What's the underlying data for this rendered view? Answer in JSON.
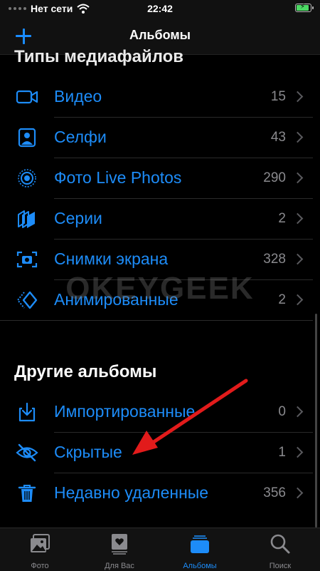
{
  "status_bar": {
    "carrier": "Нет сети",
    "time": "22:42",
    "battery_percent": 90
  },
  "nav": {
    "title": "Альбомы",
    "add_icon": "plus-icon"
  },
  "sections": {
    "media_types_title": "Типы медиафайлов",
    "media_types": [
      {
        "icon": "video-icon",
        "label": "Видео",
        "count": "15"
      },
      {
        "icon": "selfie-icon",
        "label": "Селфи",
        "count": "43"
      },
      {
        "icon": "live-photos-icon",
        "label": "Фото Live Photos",
        "count": "290"
      },
      {
        "icon": "burst-icon",
        "label": "Серии",
        "count": "2"
      },
      {
        "icon": "screenshot-icon",
        "label": "Снимки экрана",
        "count": "328"
      },
      {
        "icon": "animated-icon",
        "label": "Анимированные",
        "count": "2"
      }
    ],
    "other_title": "Другие альбомы",
    "other": [
      {
        "icon": "import-icon",
        "label": "Импортированные",
        "count": "0"
      },
      {
        "icon": "hidden-icon",
        "label": "Скрытые",
        "count": "1"
      },
      {
        "icon": "trash-icon",
        "label": "Недавно удаленные",
        "count": "356"
      }
    ]
  },
  "watermark": "OKEYGEEK",
  "tab_bar": {
    "tabs": [
      {
        "label": "Фото",
        "icon": "photo-icon",
        "active": false
      },
      {
        "label": "Для Вас",
        "icon": "for-you-icon",
        "active": false
      },
      {
        "label": "Альбомы",
        "icon": "albums-icon",
        "active": true
      },
      {
        "label": "Поиск",
        "icon": "search-icon",
        "active": false
      }
    ]
  },
  "colors": {
    "accent": "#1d8cf8",
    "background": "#000000",
    "arrow": "#e21b1b"
  }
}
